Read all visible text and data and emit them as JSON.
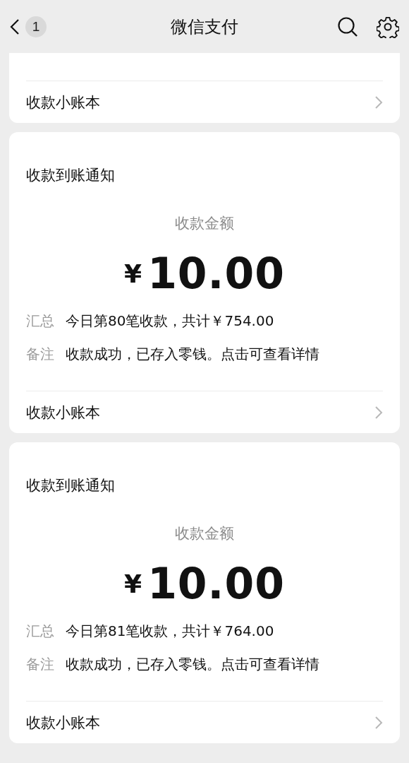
{
  "header": {
    "title": "微信支付",
    "badge": "1"
  },
  "partial_card": {
    "footer_label": "收款小账本"
  },
  "cards": [
    {
      "title": "收款到账通知",
      "amount_label": "收款金额",
      "currency": "¥",
      "amount": "10.00",
      "rows": [
        {
          "label": "汇总",
          "value": "今日第80笔收款，共计￥754.00"
        },
        {
          "label": "备注",
          "value": "收款成功，已存入零钱。点击可查看详情"
        }
      ],
      "footer_label": "收款小账本"
    },
    {
      "title": "收款到账通知",
      "amount_label": "收款金额",
      "currency": "¥",
      "amount": "10.00",
      "rows": [
        {
          "label": "汇总",
          "value": "今日第81笔收款，共计￥764.00"
        },
        {
          "label": "备注",
          "value": "收款成功，已存入零钱。点击可查看详情"
        }
      ],
      "footer_label": "收款小账本"
    }
  ]
}
